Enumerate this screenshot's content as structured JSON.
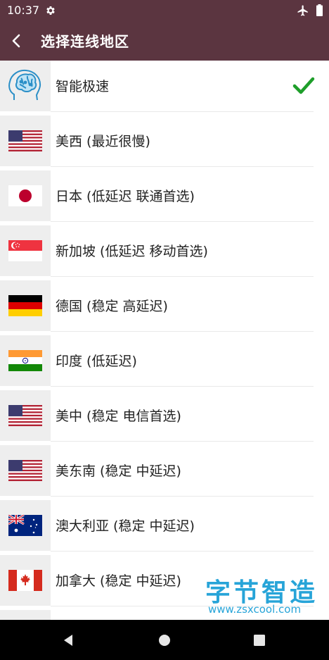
{
  "status_bar": {
    "time": "10:37",
    "icons": [
      "gear-icon",
      "airplane-mode-icon",
      "battery-icon"
    ]
  },
  "app_bar": {
    "back_icon": "back-arrow-icon",
    "title": "选择连线地区"
  },
  "regions": [
    {
      "label": "智能极速",
      "icon": "brain-icon",
      "selected": true
    },
    {
      "label": "美西 (最近很慢)",
      "icon": "flag-us-icon",
      "selected": false
    },
    {
      "label": "日本 (低延迟 联通首选)",
      "icon": "flag-japan-icon",
      "selected": false
    },
    {
      "label": "新加坡 (低延迟 移动首选)",
      "icon": "flag-singapore-icon",
      "selected": false
    },
    {
      "label": "德国 (稳定 高延迟)",
      "icon": "flag-germany-icon",
      "selected": false
    },
    {
      "label": "印度 (低延迟)",
      "icon": "flag-india-icon",
      "selected": false
    },
    {
      "label": "美中 (稳定 电信首选)",
      "icon": "flag-us-icon",
      "selected": false
    },
    {
      "label": "美东南 (稳定 中延迟)",
      "icon": "flag-us-icon",
      "selected": false
    },
    {
      "label": "澳大利亚 (稳定 中延迟)",
      "icon": "flag-australia-icon",
      "selected": false
    },
    {
      "label": "加拿大 (稳定 中延迟)",
      "icon": "flag-canada-icon",
      "selected": false
    }
  ],
  "watermark": {
    "brand": "字节智造",
    "url": "www.zsxcool.com"
  },
  "nav_bar": {
    "icons": [
      "nav-back-icon",
      "nav-home-icon",
      "nav-recents-icon"
    ]
  },
  "colors": {
    "app_bar": "#5b3540",
    "check": "#1e9e2a",
    "watermark": "#27a4d8"
  }
}
